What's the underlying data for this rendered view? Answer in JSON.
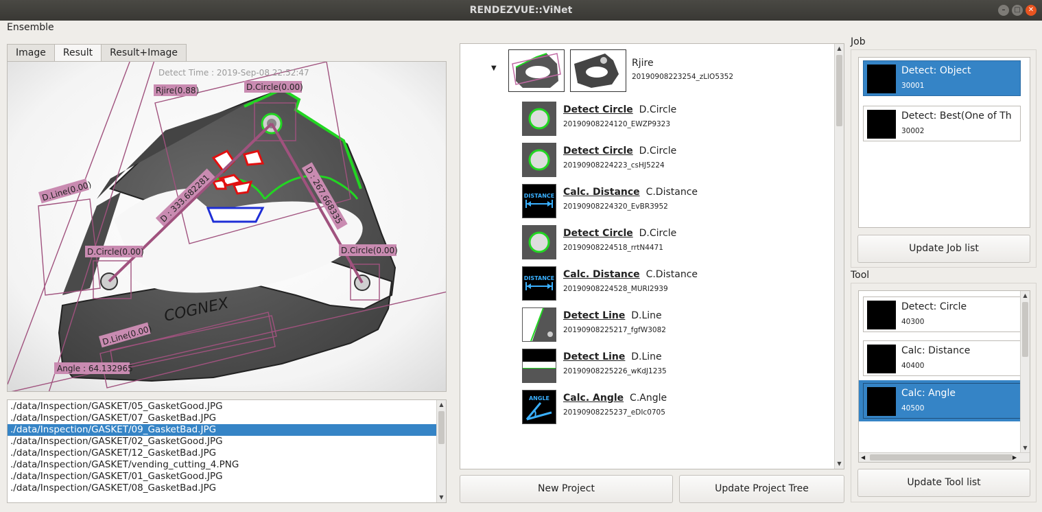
{
  "window": {
    "title": "RENDEZVUE::ViNet"
  },
  "menu": {
    "ensemble": "Ensemble"
  },
  "view_tabs": [
    "Image",
    "Result",
    "Result+Image"
  ],
  "result_view": {
    "detect_time": "Detect Time : 2019-Sep-08 22:52:47",
    "labels": {
      "rjire": "Rjire(0.88)",
      "circle_top": "D.Circle(0.00)",
      "circle_left": "D.Circle(0.00)",
      "circle_right": "D.Circle(0.00)",
      "line_left": "D.Line(0.00)",
      "line_bottom": "D.Line(0.00)",
      "dist1": "D : 333.682281",
      "dist2": "D : 267.668335",
      "angle": "Angle : 64.132965",
      "cognex": "COGNEX"
    }
  },
  "file_list": [
    "./data/Inspection/GASKET/05_GasketGood.JPG",
    "./data/Inspection/GASKET/07_GasketBad.JPG",
    "./data/Inspection/GASKET/09_GasketBad.JPG",
    "./data/Inspection/GASKET/02_GasketGood.JPG",
    "./data/Inspection/GASKET/12_GasketBad.JPG",
    "./data/Inspection/GASKET/vending_cutting_4.PNG",
    "./data/Inspection/GASKET/01_GasketGood.JPG",
    "./data/Inspection/GASKET/08_GasketBad.JPG"
  ],
  "selected_file_index": 2,
  "project_tree": {
    "root": {
      "name": "Rjire",
      "id": "20190908223254_zLlO5352"
    },
    "tools": [
      {
        "type": "Detect Circle",
        "name": "D.Circle",
        "id": "20190908224120_EWZP9323",
        "icon": "circle"
      },
      {
        "type": "Detect Circle",
        "name": "D.Circle",
        "id": "20190908224223_csHJ5224",
        "icon": "circle"
      },
      {
        "type": "Calc. Distance",
        "name": "C.Distance",
        "id": "20190908224320_EvBR3952",
        "icon": "distance"
      },
      {
        "type": "Detect Circle",
        "name": "D.Circle",
        "id": "20190908224518_rrtN4471",
        "icon": "circle"
      },
      {
        "type": "Calc. Distance",
        "name": "C.Distance",
        "id": "20190908224528_MURI2939",
        "icon": "distance"
      },
      {
        "type": "Detect Line",
        "name": "D.Line",
        "id": "20190908225217_fgfW3082",
        "icon": "line-diag"
      },
      {
        "type": "Detect Line",
        "name": "D.Line",
        "id": "20190908225226_wKdJ1235",
        "icon": "line-horiz"
      },
      {
        "type": "Calc. Angle",
        "name": "C.Angle",
        "id": "20190908225237_eDIc0705",
        "icon": "angle"
      }
    ],
    "icon_text": {
      "distance": "DISTANCE",
      "angle": "ANGLE"
    }
  },
  "buttons": {
    "new_project": "New Project",
    "update_project_tree": "Update Project Tree",
    "update_job_list": "Update Job list",
    "update_tool_list": "Update Tool list"
  },
  "job": {
    "label": "Job",
    "items": [
      {
        "name": "Detect: Object",
        "id": "30001",
        "selected": true
      },
      {
        "name": "Detect: Best(One of Th",
        "id": "30002",
        "selected": false
      }
    ]
  },
  "tool": {
    "label": "Tool",
    "items": [
      {
        "name": "Detect: Circle",
        "id": "40300",
        "selected": false
      },
      {
        "name": "Calc: Distance",
        "id": "40400",
        "selected": false
      },
      {
        "name": "Calc: Angle",
        "id": "40500",
        "selected": true
      }
    ]
  },
  "colors": {
    "selection": "#3584c6",
    "overlay": "#a0527e",
    "detect_green": "#22d622",
    "defect_red": "#e01010"
  }
}
